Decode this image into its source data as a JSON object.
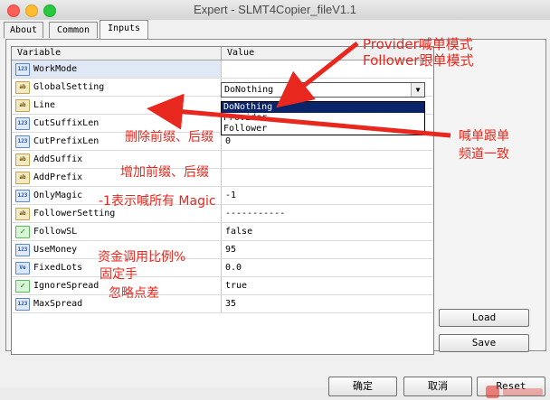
{
  "window": {
    "title": "Expert - SLMT4Copier_fileV1.1"
  },
  "tabs": [
    {
      "label": "About"
    },
    {
      "label": "Common"
    },
    {
      "label": "Inputs"
    }
  ],
  "grid": {
    "headers": {
      "variable": "Variable",
      "value": "Value"
    },
    "rows": [
      {
        "icon": "num",
        "name": "WorkMode",
        "value": ""
      },
      {
        "icon": "ab",
        "name": "GlobalSetting",
        "value": ""
      },
      {
        "icon": "ab",
        "name": "Line",
        "value": ""
      },
      {
        "icon": "num",
        "name": "CutSuffixLen",
        "value": "0"
      },
      {
        "icon": "num",
        "name": "CutPrefixLen",
        "value": "0"
      },
      {
        "icon": "ab",
        "name": "AddSuffix",
        "value": ""
      },
      {
        "icon": "ab",
        "name": "AddPrefix",
        "value": ""
      },
      {
        "icon": "num",
        "name": "OnlyMagic",
        "value": "-1"
      },
      {
        "icon": "ab",
        "name": "FollowerSetting",
        "value": "-----------"
      },
      {
        "icon": "bool",
        "name": "FollowSL",
        "value": "false"
      },
      {
        "icon": "num",
        "name": "UseMoney",
        "value": "95"
      },
      {
        "icon": "ve",
        "name": "FixedLots",
        "value": "0.0"
      },
      {
        "icon": "bool",
        "name": "IgnoreSpread",
        "value": "true"
      },
      {
        "icon": "num",
        "name": "MaxSpread",
        "value": "35"
      }
    ]
  },
  "workmode_select": {
    "selected": "DoNothing",
    "options": [
      "DoNothing",
      "Provider",
      "Follower"
    ]
  },
  "buttons": {
    "load": "Load",
    "save": "Save",
    "ok": "确定",
    "cancel": "取消",
    "reset": "Reset"
  },
  "annotations": {
    "provider_mode": "Provider喊单模式",
    "follower_mode": "Follower跟单模式",
    "line_consistent_1": "喊单跟单",
    "line_consistent_2": "频道一致",
    "delete_affix": "删除前缀、后缀",
    "add_affix": "增加前缀、后缀",
    "only_magic": "-1表示喊所有 Magic",
    "use_money": "资金调用比例%",
    "fixed_lots": "固定手",
    "ignore_spread": "忽略点差"
  },
  "colors": {
    "annotation": "#e8281e",
    "selection": "#0a246a"
  },
  "icons": {
    "num": "123",
    "ab": "ab",
    "bool": "✓",
    "ve": "Ve"
  }
}
